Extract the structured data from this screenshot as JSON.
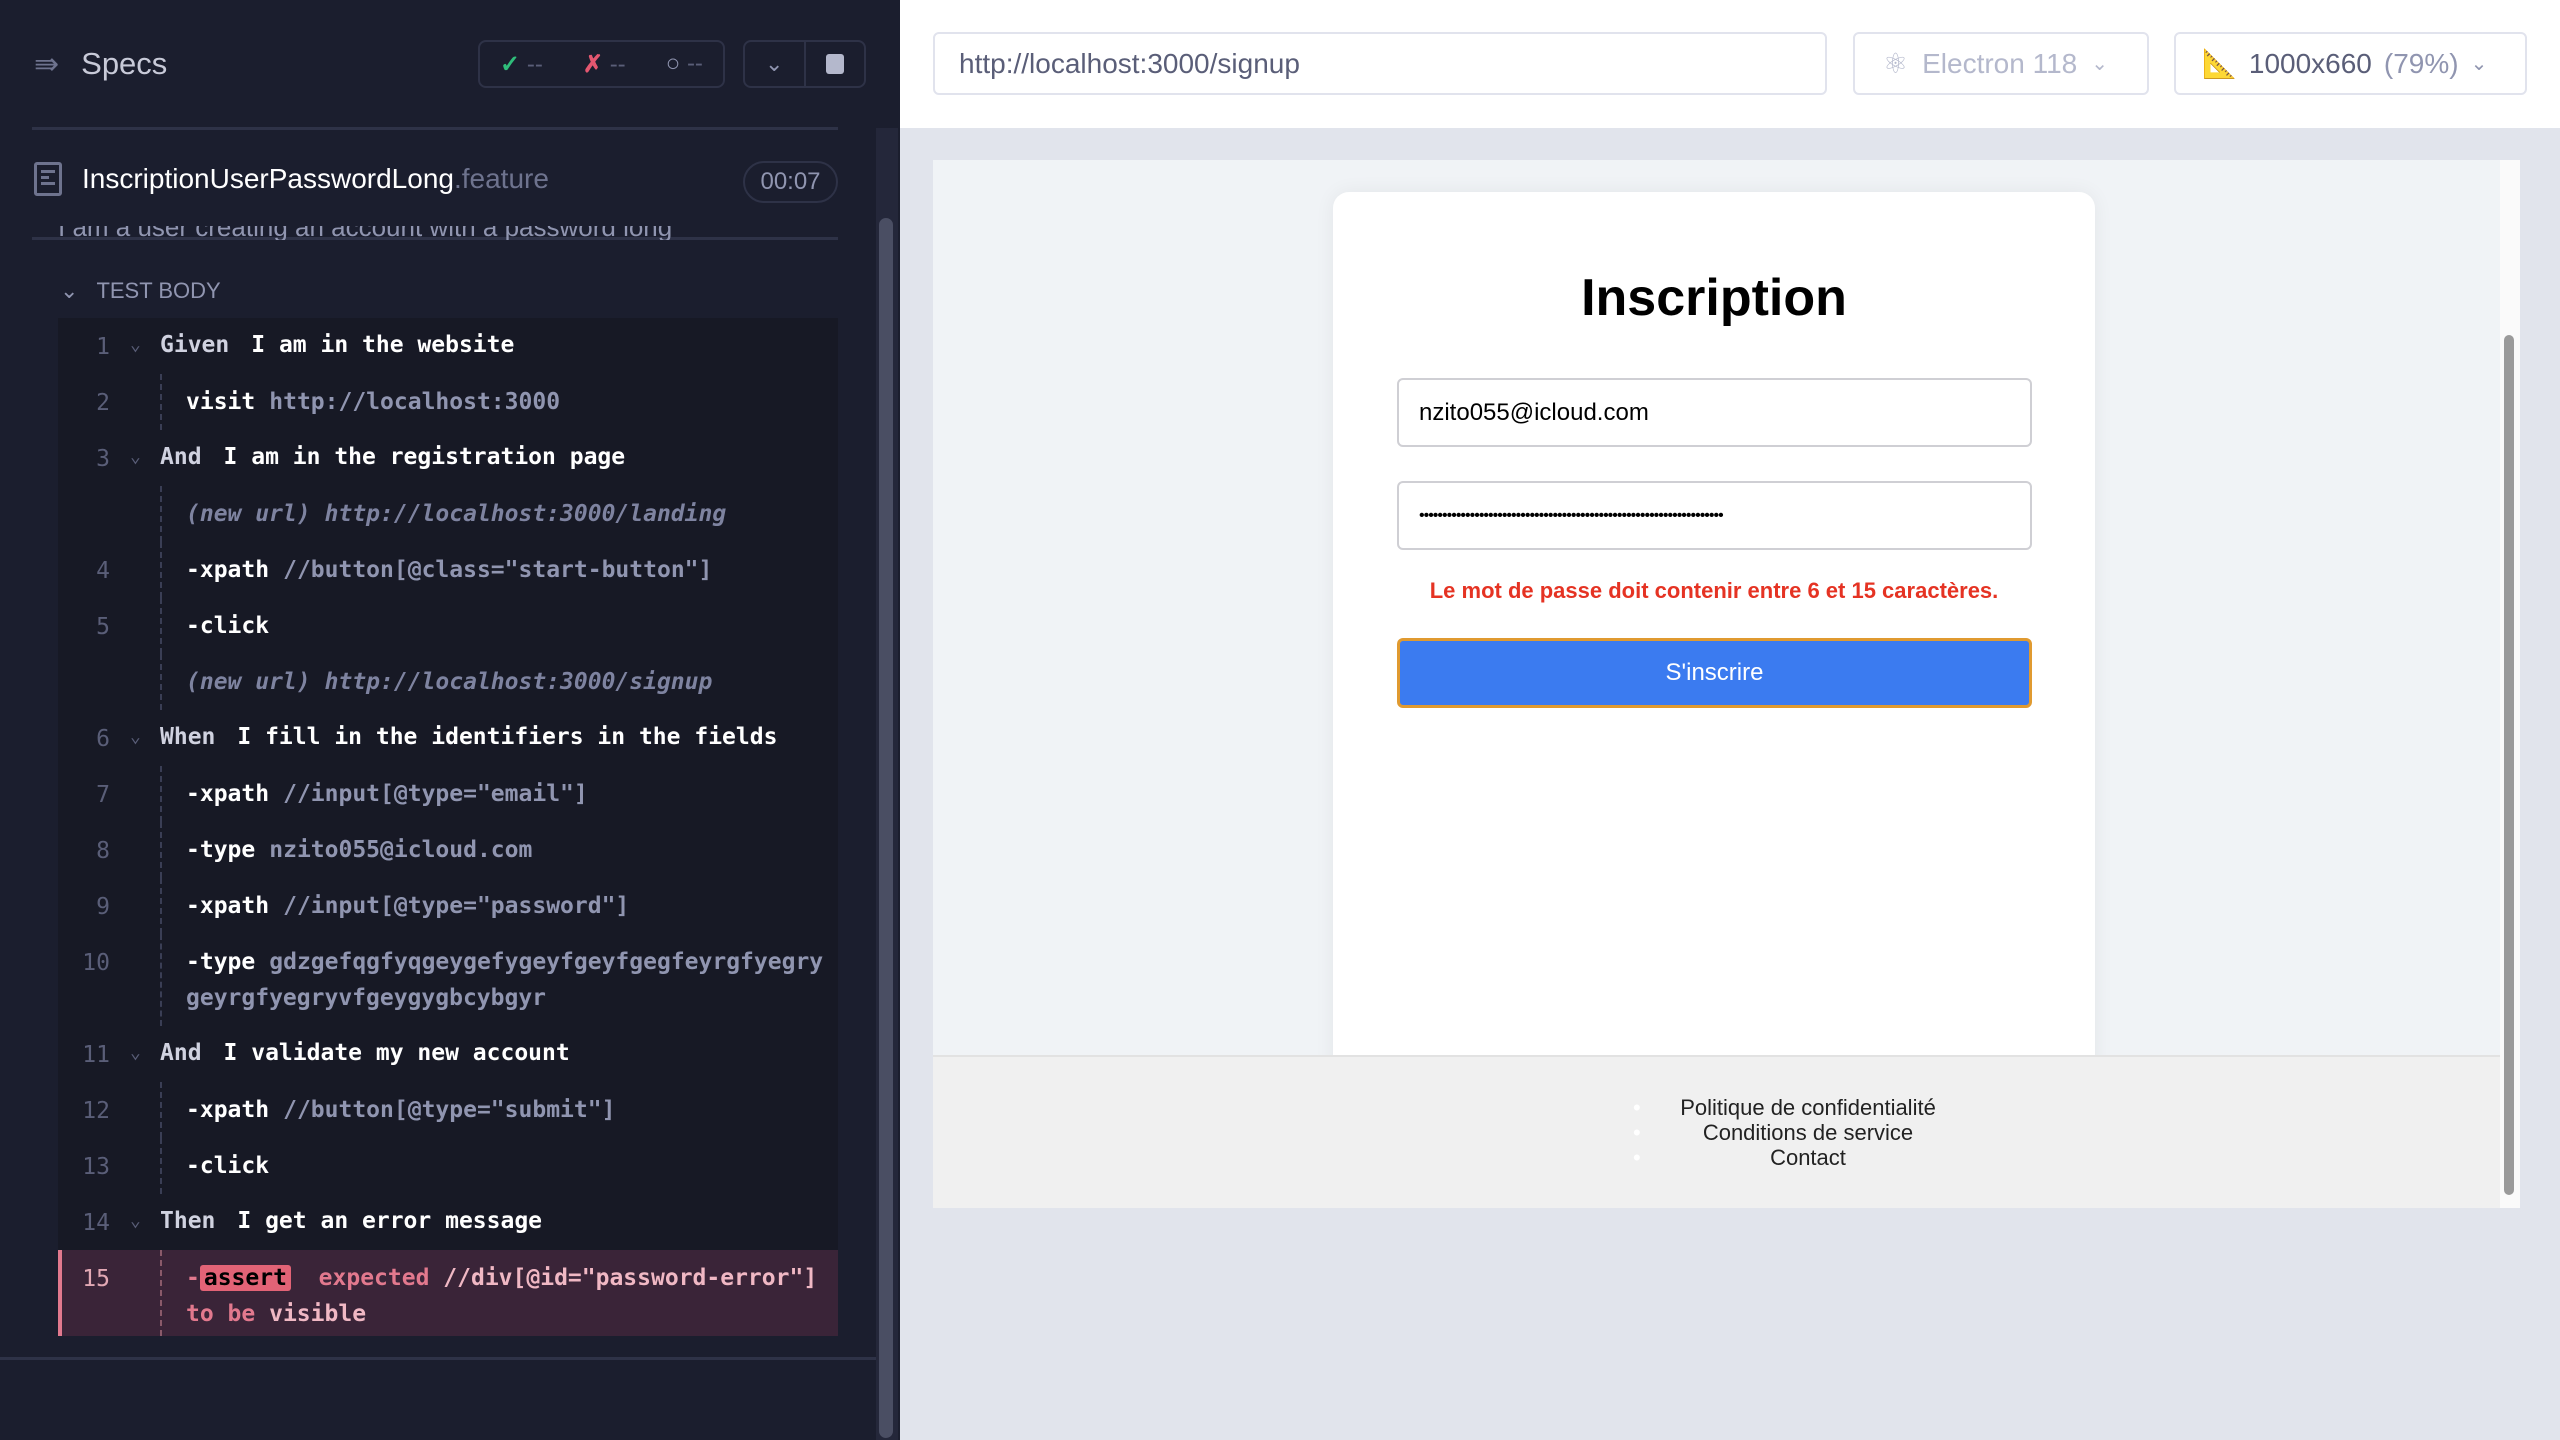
{
  "reporter": {
    "title": "Specs",
    "stats": {
      "passed": "--",
      "failed": "--",
      "pending": "--"
    },
    "file": {
      "name": "InscriptionUserPasswordLong",
      "ext": ".feature",
      "duration": "00:07"
    },
    "scenario": "I am a user creating an account with a password long",
    "section": "TEST BODY",
    "lines": [
      {
        "num": "1",
        "type": "step",
        "kw": "Given",
        "text": "I am in the website"
      },
      {
        "num": "2",
        "type": "cmd",
        "cmd": "visit",
        "arg": "http://localhost:3000"
      },
      {
        "num": "3",
        "type": "step",
        "kw": "And",
        "text": "I am in the registration page"
      },
      {
        "num": "",
        "type": "url",
        "cmd": "(new url)",
        "arg": "http://localhost:3000/landing"
      },
      {
        "num": "4",
        "type": "cmd",
        "cmd": "-xpath",
        "arg": "//button[@class=\"start-button\"]"
      },
      {
        "num": "5",
        "type": "cmd",
        "cmd": "-click",
        "arg": ""
      },
      {
        "num": "",
        "type": "url",
        "cmd": "(new url)",
        "arg": "http://localhost:3000/signup"
      },
      {
        "num": "6",
        "type": "step",
        "kw": "When",
        "text": "I fill in the identifiers in the fields"
      },
      {
        "num": "7",
        "type": "cmd",
        "cmd": "-xpath",
        "arg": "//input[@type=\"email\"]"
      },
      {
        "num": "8",
        "type": "cmd",
        "cmd": "-type",
        "arg": "nzito055@icloud.com"
      },
      {
        "num": "9",
        "type": "cmd",
        "cmd": "-xpath",
        "arg": "//input[@type=\"password\"]"
      },
      {
        "num": "10",
        "type": "cmd",
        "cmd": "-type",
        "arg": "gdzgefqgfyqgeygefygeyfgeyfgegfeyrgfyegrygeyrgfyegryvfgeygygbcybgyr",
        "wrap": true
      },
      {
        "num": "11",
        "type": "step",
        "kw": "And",
        "text": "I validate my new account"
      },
      {
        "num": "12",
        "type": "cmd",
        "cmd": "-xpath",
        "arg": "//button[@type=\"submit\"]"
      },
      {
        "num": "13",
        "type": "cmd",
        "cmd": "-click",
        "arg": ""
      },
      {
        "num": "14",
        "type": "step",
        "kw": "Then",
        "text": "I get an error message"
      },
      {
        "num": "15",
        "type": "fail",
        "cmd": "assert",
        "expected": "expected",
        "selector": "//div[@id=\"password-error\"]",
        "tobe": "to be",
        "state": "visible"
      }
    ]
  },
  "browser": {
    "url": "http://localhost:3000/signup",
    "engine": "Electron 118",
    "viewport": "1000x660",
    "zoom": "(79%)"
  },
  "app": {
    "title": "Inscription",
    "email": "nzito055@icloud.com",
    "password": "••••••••••••••••••••••••••••••••••••••••••••••••••••••••••••••••••",
    "error": "Le mot de passe doit contenir entre 6 et 15 caractères.",
    "submit": "S'inscrire",
    "footer_links": [
      "Politique de confidentialité",
      "Conditions de service",
      "Contact"
    ]
  },
  "colors": {
    "accent": "#3b7bf0",
    "error": "#e53323",
    "fail": "#e26376",
    "pass": "#2fbd7a"
  }
}
